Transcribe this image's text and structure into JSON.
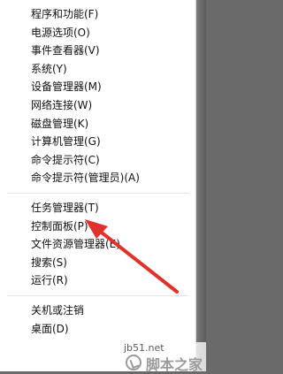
{
  "menu": {
    "group1": [
      {
        "label": "程序和功能(F)",
        "name": "menu-item-programs-and-features"
      },
      {
        "label": "电源选项(O)",
        "name": "menu-item-power-options"
      },
      {
        "label": "事件查看器(V)",
        "name": "menu-item-event-viewer"
      },
      {
        "label": "系统(Y)",
        "name": "menu-item-system"
      },
      {
        "label": "设备管理器(M)",
        "name": "menu-item-device-manager"
      },
      {
        "label": "网络连接(W)",
        "name": "menu-item-network-connections"
      },
      {
        "label": "磁盘管理(K)",
        "name": "menu-item-disk-management"
      },
      {
        "label": "计算机管理(G)",
        "name": "menu-item-computer-management"
      },
      {
        "label": "命令提示符(C)",
        "name": "menu-item-command-prompt"
      },
      {
        "label": "命令提示符(管理员)(A)",
        "name": "menu-item-command-prompt-admin"
      }
    ],
    "group2": [
      {
        "label": "任务管理器(T)",
        "name": "menu-item-task-manager"
      },
      {
        "label": "控制面板(P)",
        "name": "menu-item-control-panel"
      },
      {
        "label": "文件资源管理器(E)",
        "name": "menu-item-file-explorer"
      },
      {
        "label": "搜索(S)",
        "name": "menu-item-search"
      },
      {
        "label": "运行(R)",
        "name": "menu-item-run"
      }
    ],
    "group3": [
      {
        "label": "关机或注销",
        "name": "menu-item-shutdown-signout"
      },
      {
        "label": "桌面(D)",
        "name": "menu-item-desktop"
      }
    ]
  },
  "annotation": {
    "arrow_color": "#e0312b"
  },
  "watermark": {
    "url": "jb51.net",
    "name": "脚本之家"
  }
}
